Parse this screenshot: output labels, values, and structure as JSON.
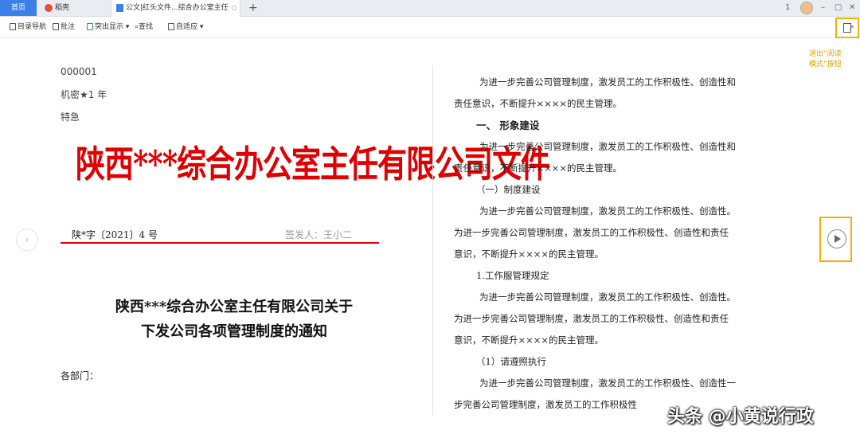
{
  "tabs": {
    "home": "首页",
    "daoke": "稻壳",
    "document": "公文|红头文件...综合办公室主任",
    "add": "+"
  },
  "window_controls": {
    "badge": "1",
    "restore": "▢",
    "close": "✕"
  },
  "toolbar": {
    "outline": "目录导航",
    "comment": "批注",
    "highlight": "突出显示 ▾",
    "find": "查找",
    "fit": "自适应 ▾"
  },
  "annotation": {
    "line1": "退出“阅读",
    "line2": "模式”按钮"
  },
  "left_page": {
    "serial": "000001",
    "secret": "机密★1 年",
    "urgency": "特急",
    "red_title": "陕西***综合办公室主任有限公司文件",
    "doc_number": "陕*字〔2021〕4 号",
    "signer": "签发人：王小二",
    "heading_line1": "陕西***综合办公室主任有限公司关于",
    "heading_line2": "下发公司各项管理制度的通知",
    "addressee": "各部门："
  },
  "right_page": {
    "lines": [
      "为进一步完善公司管理制度，激发员工的工作积极性、创造性和",
      "责任意识，不断提升××××的民主管理。",
      "一、 形象建设",
      "为进一步完善公司管理制度，激发员工的工作积极性、创造性和",
      "责任意识，不断提升××××的民主管理。",
      "（一）制度建设",
      "为进一步完善公司管理制度，激发员工的工作积极性、创造性。",
      "为进一步完善公司管理制度，激发员工的工作积极性、创造性和责任",
      "意识，不断提升××××的民主管理。",
      "1.工作服管理规定",
      "为进一步完善公司管理制度，激发员工的工作积极性、创造性。",
      "为进一步完善公司管理制度，激发员工的工作积极性、创造性和责任",
      "意识，不断提升××××的民主管理。",
      "（1）请遵照执行",
      "为进一步完善公司管理制度，激发员工的工作积极性、创造性一",
      "步完善公司管理制度，激发员工的工作积极性"
    ]
  },
  "watermark": "头条 @小黄说行政",
  "icons": {
    "prev": "chevron-left-icon",
    "next": "play-icon",
    "exit": "exit-reading-mode-icon"
  },
  "colors": {
    "accent": "#3d7fe9",
    "red_header": "#e00000",
    "highlight_border": "#f0b100"
  }
}
